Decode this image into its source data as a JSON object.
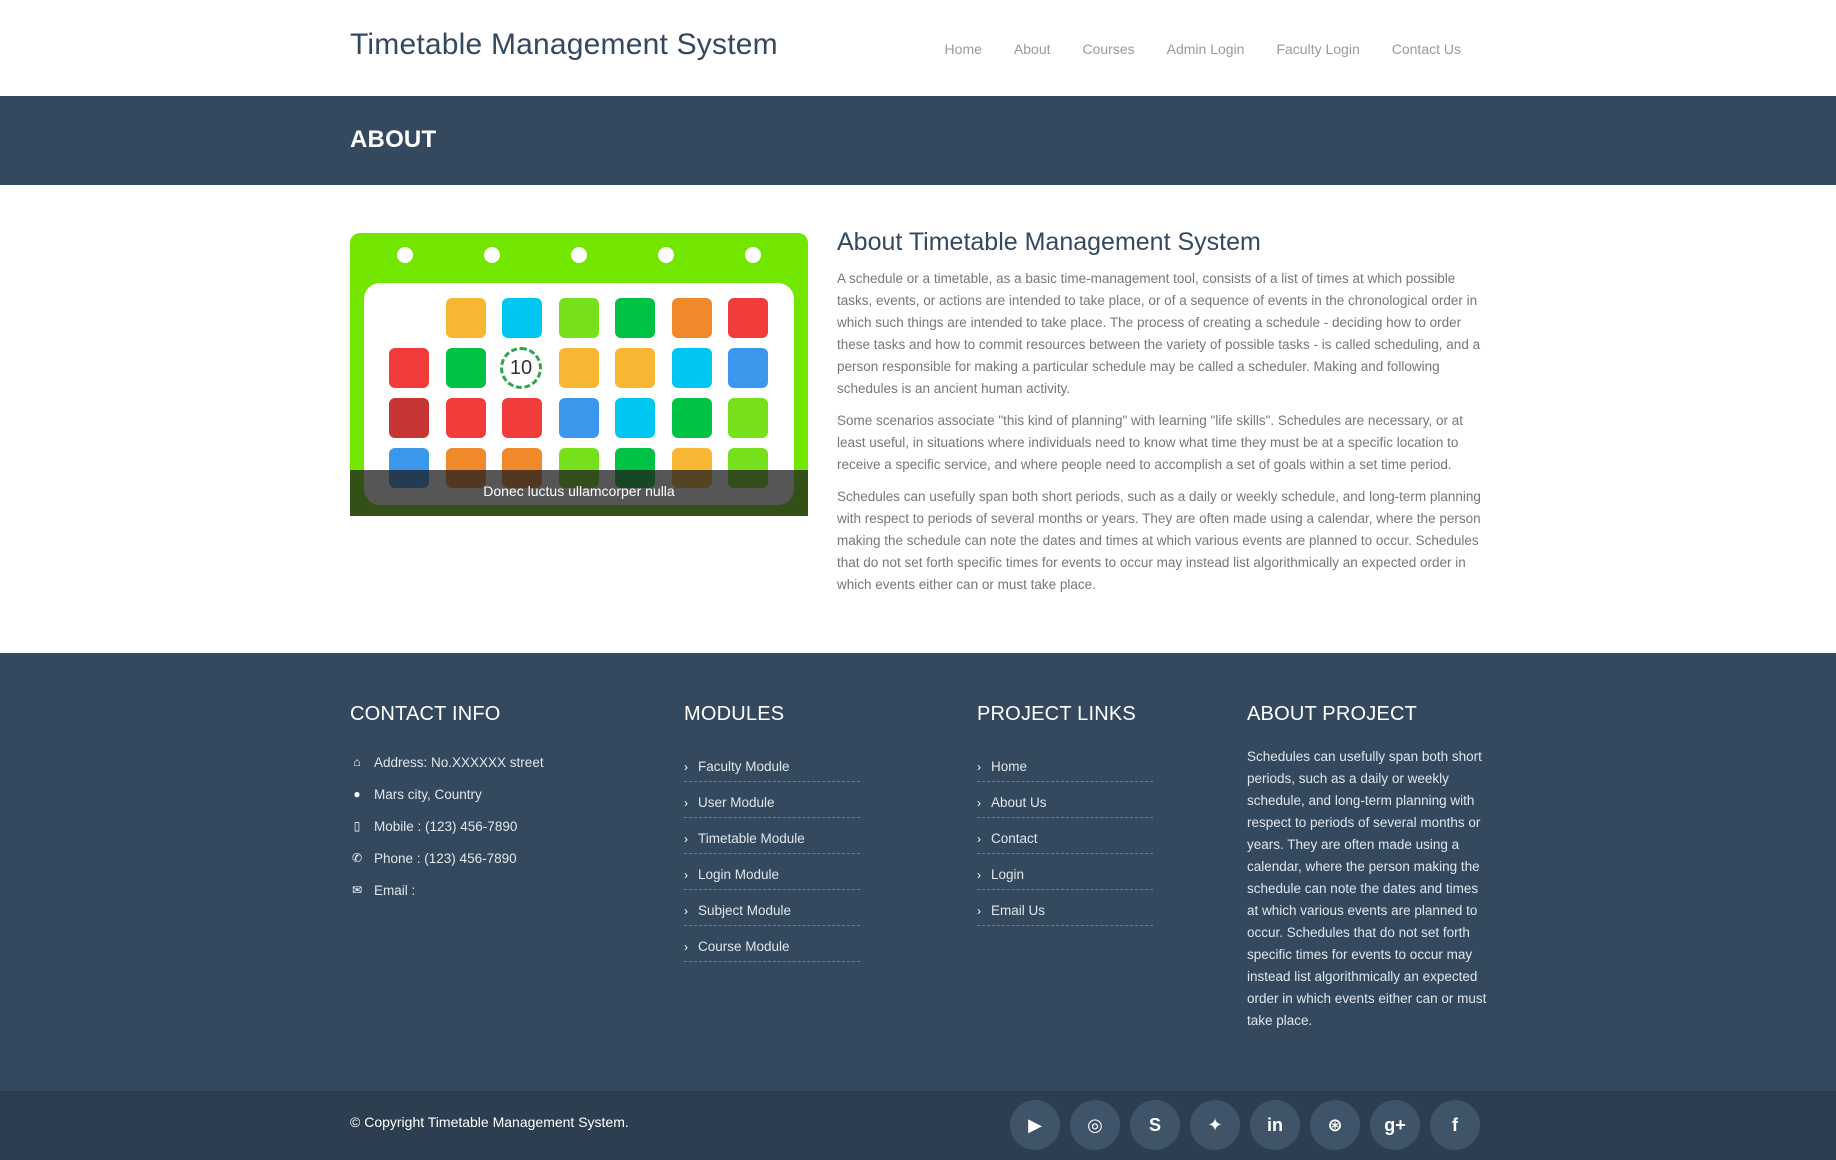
{
  "header": {
    "brand": "Timetable Management System",
    "nav": [
      "Home",
      "About",
      "Courses",
      "Admin Login",
      "Faculty Login",
      "Contact Us"
    ]
  },
  "band": {
    "title": "ABOUT"
  },
  "image": {
    "caption": "Donec luctus ullamcorper nulla",
    "day_number": "10"
  },
  "about": {
    "title": "About Timetable Management System",
    "paragraphs": [
      "A schedule or a timetable, as a basic time-management tool, consists of a list of times at which possible tasks, events, or actions are intended to take place, or of a sequence of events in the chronological order in which such things are intended to take place. The process of creating a schedule - deciding how to order these tasks and how to commit resources between the variety of possible tasks - is called scheduling, and a person responsible for making a particular schedule may be called a scheduler. Making and following schedules is an ancient human activity.",
      "Some scenarios associate \"this kind of planning\" with learning \"life skills\". Schedules are necessary, or at least useful, in situations where individuals need to know what time they must be at a specific location to receive a specific service, and where people need to accomplish a set of goals within a set time period.",
      "Schedules can usefully span both short periods, such as a daily or weekly schedule, and long-term planning with respect to periods of several months or years. They are often made using a calendar, where the person making the schedule can note the dates and times at which various events are planned to occur. Schedules that do not set forth specific times for events to occur may instead list algorithmically an expected order in which events either can or must take place."
    ]
  },
  "footer": {
    "contact": {
      "title": "CONTACT INFO",
      "address": "Address: No.XXXXXX street",
      "city": "Mars city, Country",
      "mobile": "Mobile : (123) 456-7890",
      "phone": "Phone : (123) 456-7890",
      "email": "Email :"
    },
    "modules": {
      "title": "MODULES",
      "items": [
        "Faculty Module",
        "User Module",
        "Timetable Module",
        "Login Module",
        "Subject Module",
        "Course Module"
      ]
    },
    "links": {
      "title": "PROJECT LINKS",
      "items": [
        "Home",
        "About Us",
        "Contact",
        "Login",
        "Email Us"
      ]
    },
    "about_project": {
      "title": "ABOUT PROJECT",
      "text": "Schedules can usefully span both short periods, such as a daily or weekly schedule, and long-term planning with respect to periods of several months or years. They are often made using a calendar, where the person making the schedule can note the dates and times at which various events are planned to occur. Schedules that do not set forth specific times for events to occur may instead list algorithmically an expected order in which events either can or must take place."
    },
    "copyright": "© Copyright Timetable Management System.",
    "social": [
      {
        "name": "youtube",
        "glyph": "▶"
      },
      {
        "name": "github",
        "glyph": "◎"
      },
      {
        "name": "skype",
        "glyph": "S"
      },
      {
        "name": "twitter",
        "glyph": "✦"
      },
      {
        "name": "linkedin",
        "glyph": "in"
      },
      {
        "name": "dribbble",
        "glyph": "⊛"
      },
      {
        "name": "google-plus",
        "glyph": "g+"
      },
      {
        "name": "facebook",
        "glyph": "f"
      }
    ]
  }
}
